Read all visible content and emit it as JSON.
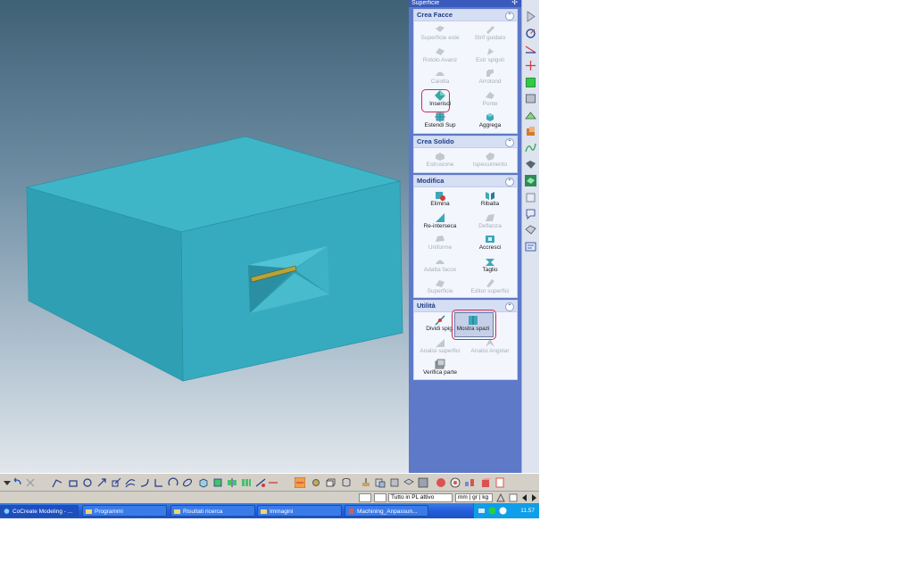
{
  "panel": {
    "title": "Superficie",
    "sections": [
      {
        "title": "Crea Facce",
        "tools": [
          {
            "label": "Superficie este",
            "icon": "surface-extrude-icon",
            "enabled": false
          },
          {
            "label": "Strif guidato",
            "icon": "guided-strip-icon",
            "enabled": false
          },
          {
            "label": "Rotolo Avanz",
            "icon": "advanced-roll-icon",
            "enabled": false
          },
          {
            "label": "Estr spigoli",
            "icon": "extract-edges-icon",
            "enabled": false
          },
          {
            "label": "Calotta",
            "icon": "cap-icon",
            "enabled": false
          },
          {
            "label": "Arrotond",
            "icon": "round-icon",
            "enabled": false
          },
          {
            "label": "Inserisci",
            "icon": "insert-icon",
            "enabled": true,
            "highlighted": true
          },
          {
            "label": "Ponte",
            "icon": "bridge-icon",
            "enabled": false
          },
          {
            "label": "Estendi Sup",
            "icon": "extend-surface-icon",
            "enabled": true
          },
          {
            "label": "Aggrega",
            "icon": "aggregate-icon",
            "enabled": true
          }
        ]
      },
      {
        "title": "Crea Solido",
        "tools": [
          {
            "label": "Estrusione",
            "icon": "extrusion-icon",
            "enabled": false
          },
          {
            "label": "Ispessimento",
            "icon": "thicken-icon",
            "enabled": false
          }
        ]
      },
      {
        "title": "Modifica",
        "tools": [
          {
            "label": "Elimina",
            "icon": "delete-face-icon",
            "enabled": true
          },
          {
            "label": "Ribalta",
            "icon": "flip-icon",
            "enabled": true
          },
          {
            "label": "Re-interseca",
            "icon": "reintersect-icon",
            "enabled": true
          },
          {
            "label": "Deflanza",
            "icon": "deflange-icon",
            "enabled": false
          },
          {
            "label": "Uniforme",
            "icon": "uniform-icon",
            "enabled": false
          },
          {
            "label": "Accresci",
            "icon": "grow-icon",
            "enabled": true
          },
          {
            "label": "Adatta facce",
            "icon": "adapt-faces-icon",
            "enabled": false
          },
          {
            "label": "Taglio",
            "icon": "cut-icon",
            "enabled": true
          },
          {
            "label": "Superficie",
            "icon": "surface-icon",
            "enabled": false
          },
          {
            "label": "Editor superfici",
            "icon": "surface-editor-icon",
            "enabled": false
          }
        ]
      },
      {
        "title": "Utilità",
        "tools": [
          {
            "label": "Dividi spig.",
            "icon": "split-edge-icon",
            "enabled": true
          },
          {
            "label": "Mostra spazi",
            "icon": "show-gaps-icon",
            "enabled": true,
            "highlighted": true,
            "pressed": true
          },
          {
            "label": "Analisi superfici",
            "icon": "surface-analysis-icon",
            "enabled": false
          },
          {
            "label": "Analisi Angolar",
            "icon": "angle-analysis-icon",
            "enabled": false
          },
          {
            "label": "Verifica parte",
            "icon": "check-part-icon",
            "enabled": true
          }
        ]
      }
    ]
  },
  "statusbar": {
    "mode": "Tutto in PL attivo",
    "units": [
      "mm",
      "gr",
      "kg"
    ],
    "unit_separator": "|"
  },
  "taskbar": {
    "start_label": "CoCreate Modeling - ...",
    "tasks": [
      {
        "label": "Programmi",
        "icon": "folder-icon"
      },
      {
        "label": "Risultati ricerca",
        "icon": "search-results-icon"
      },
      {
        "label": "Immagini",
        "icon": "folder-icon"
      },
      {
        "label": "Machining_Anpassun...",
        "icon": "document-icon"
      }
    ],
    "clock": "11.57"
  },
  "colors": {
    "model_face_top": "#3eb6c8",
    "model_face_front": "#34a9bd",
    "model_face_side": "#2e9cb0",
    "panel_background": "#5e79c8",
    "section_header": "#d5def3",
    "highlight": "#d12b4e",
    "taskbar": "#245edb"
  }
}
